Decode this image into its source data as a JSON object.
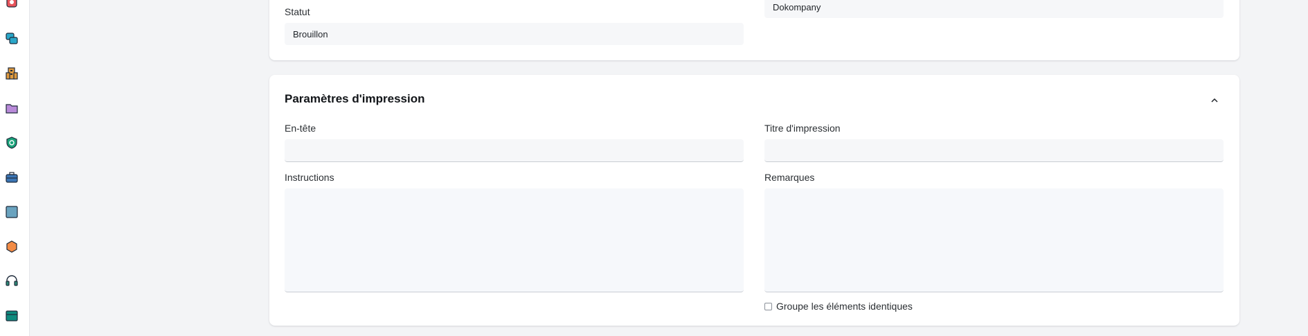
{
  "sidebar": {
    "icons": [
      {
        "name": "heart-ticket-icon",
        "color": "#e8545b"
      },
      {
        "name": "database-stack-icon",
        "color": "#2aa7c9"
      },
      {
        "name": "building-icon",
        "color": "#e09a3d"
      },
      {
        "name": "folder-icon",
        "color": "#b98ad9"
      },
      {
        "name": "shield-icon",
        "color": "#1aa37a"
      },
      {
        "name": "briefcase-icon",
        "color": "#3b76b5"
      },
      {
        "name": "window-icon",
        "color": "#6aa3bf"
      },
      {
        "name": "hexagon-icon",
        "color": "#f28b45"
      },
      {
        "name": "headset-icon",
        "color": "#2c8c76"
      },
      {
        "name": "card-icon",
        "color": "#0f8a7e"
      }
    ]
  },
  "top_card": {
    "status_label": "Statut",
    "status_value": "Brouillon",
    "company_value": "Dokompany"
  },
  "print_settings": {
    "title": "Paramètres d'impression",
    "header_label": "En-tête",
    "header_value": "",
    "print_title_label": "Titre d'impression",
    "print_title_value": "",
    "instructions_label": "Instructions",
    "instructions_value": "",
    "remarks_label": "Remarques",
    "remarks_value": "",
    "group_checkbox_label": "Groupe les éléments identiques",
    "group_checkbox_checked": false
  }
}
